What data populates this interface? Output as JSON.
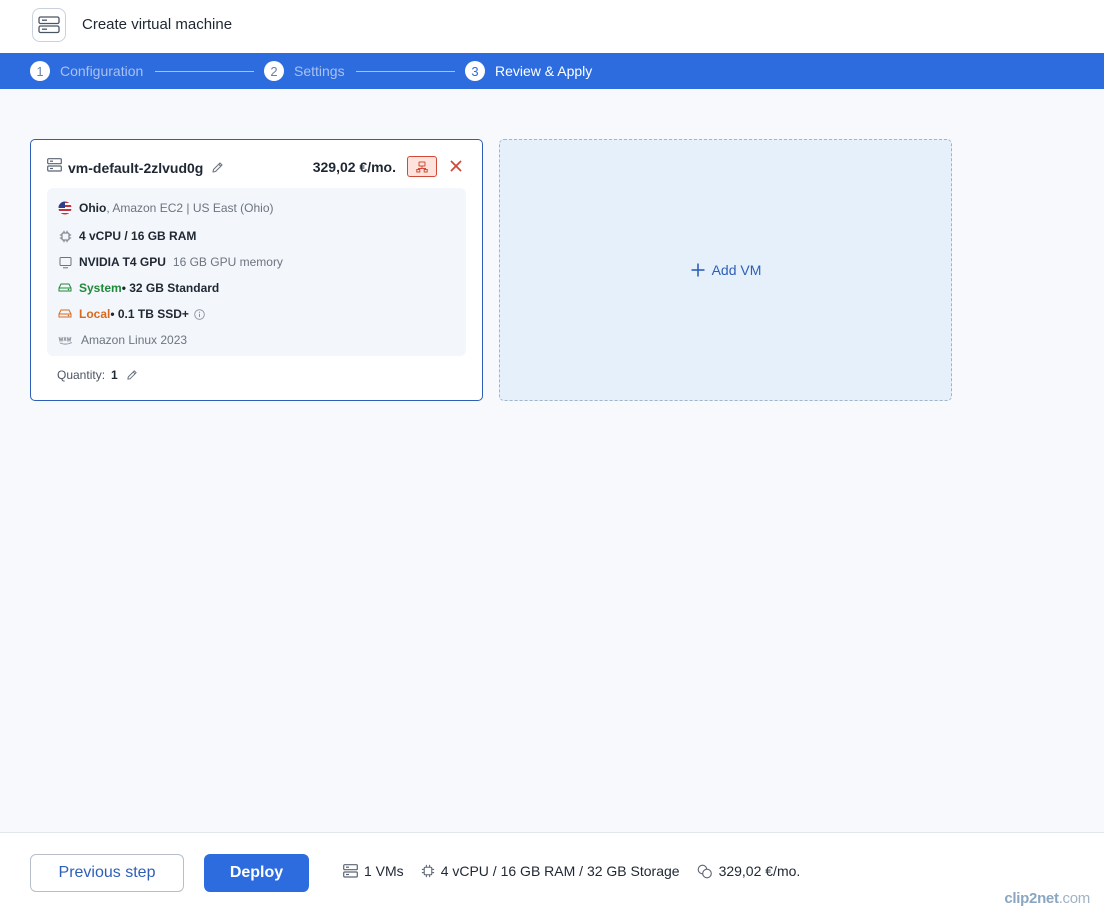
{
  "header": {
    "title": "Create virtual machine",
    "icon": "server-icon"
  },
  "stepper": {
    "steps": [
      {
        "num": "1",
        "label": "Configuration",
        "active": false
      },
      {
        "num": "2",
        "label": "Settings",
        "active": false
      },
      {
        "num": "3",
        "label": "Review & Apply",
        "active": true
      }
    ]
  },
  "vm": {
    "name": "vm-default-2zlvud0g",
    "price": "329,02 €/mo.",
    "location": {
      "city": "Ohio",
      "rest": ", Amazon EC2 | US East (Ohio)"
    },
    "cpu_ram": "4 vCPU / 16 GB RAM",
    "gpu": {
      "name": "NVIDIA T4 GPU",
      "memory": "16 GB GPU memory"
    },
    "system_disk": {
      "label": "System",
      "value": " • 32 GB Standard"
    },
    "local_disk": {
      "label": "Local",
      "value": " • 0.1 TB SSD+"
    },
    "os": "Amazon Linux 2023",
    "quantity_label": "Quantity:",
    "quantity": "1"
  },
  "add_vm": {
    "label": "Add VM"
  },
  "footer": {
    "prev_label": "Previous step",
    "deploy_label": "Deploy",
    "summary_vms": "1 VMs",
    "summary_resources": "4 vCPU / 16 GB RAM / 32 GB Storage",
    "summary_price": "329,02 €/mo."
  },
  "watermark": {
    "brand": "clip2net",
    "suffix": ".com"
  },
  "colors": {
    "primary": "#2d6cdf",
    "card_border": "#2d5fb8",
    "danger": "#d04a37",
    "green": "#1f8a3a",
    "orange": "#d86a1f"
  }
}
